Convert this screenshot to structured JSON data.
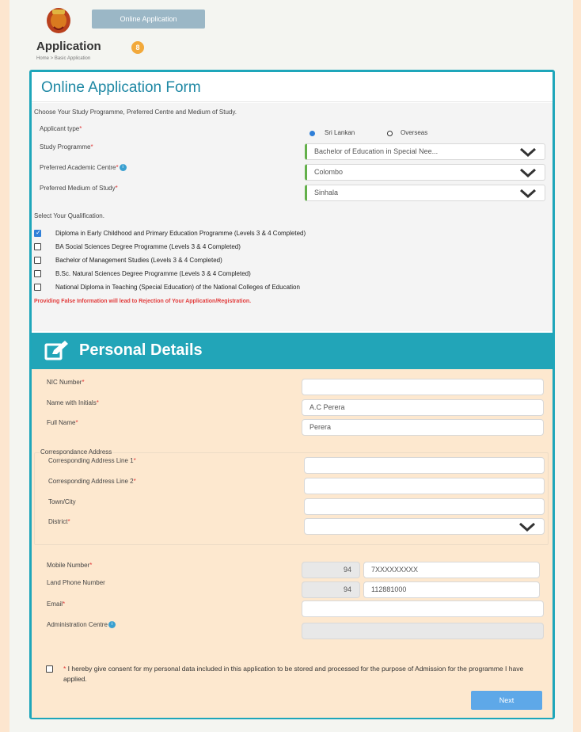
{
  "header": {
    "online_application_button": "Online Application",
    "page_title": "Application",
    "title_badge": "8",
    "breadcrumb": "Home > Basic Application"
  },
  "form": {
    "title": "Online Application Form",
    "study_instruction": "Choose Your Study Programme, Preferred Centre and Medium of Study.",
    "applicant_type_label": "Applicant type",
    "applicant_type_options": [
      "Sri Lankan",
      "Overseas"
    ],
    "applicant_type_selected": "Sri Lankan",
    "study_programme_label": "Study Programme",
    "study_programme_value": "Bachelor of Education in Special Nee...",
    "academic_centre_label": "Preferred Academic Centre",
    "academic_centre_value": "Colombo",
    "medium_label": "Preferred Medium of Study",
    "medium_value": "Sinhala",
    "qualification_instruction": "Select Your Qualification.",
    "qualifications": [
      {
        "label": "Diploma in Early Childhood and Primary Education Programme (Levels 3 & 4 Completed)",
        "checked": true
      },
      {
        "label": "BA Social Sciences Degree Programme (Levels 3 & 4 Completed)",
        "checked": false
      },
      {
        "label": "Bachelor of Management Studies (Levels 3 & 4 Completed)",
        "checked": false
      },
      {
        "label": "B.Sc. Natural Sciences Degree Programme (Levels 3 & 4 Completed)",
        "checked": false
      },
      {
        "label": "National Diploma in Teaching (Special Education) of the National Colleges of Education",
        "checked": false
      }
    ],
    "warning": "Providing False Information will lead to Rejection of Your Application/Registration."
  },
  "personal": {
    "section_title": "Personal Details",
    "nic_label": "NIC Number",
    "nic_value": "",
    "name_initials_label": "Name with Initials",
    "name_initials_value": "A.C Perera",
    "full_name_label": "Full Name",
    "full_name_value": "Perera",
    "correspondence_legend": "Correspondance Address",
    "address1_label": "Corresponding Address Line 1",
    "address1_value": "",
    "address2_label": "Corresponding Address Line 2",
    "address2_value": "",
    "town_label": "Town/City",
    "town_value": "",
    "district_label": "District",
    "district_value": "",
    "mobile_label": "Mobile Number",
    "mobile_code": "94",
    "mobile_placeholder": "7XXXXXXXXX",
    "land_label": "Land Phone Number",
    "land_code": "94",
    "land_placeholder": "112881000",
    "email_label": "Email",
    "email_value": "",
    "admin_centre_label": "Administration Centre",
    "admin_centre_value": "",
    "consent_text": "I hereby give consent for my personal data included in this application to be stored and processed for the purpose of Admission for the programme I have applied.",
    "next_button": "Next"
  },
  "colors": {
    "accent_teal": "#22a5b8",
    "required_red": "#e23b3b",
    "button_blue": "#5ea8e8",
    "personal_bg": "#fde8cf"
  }
}
